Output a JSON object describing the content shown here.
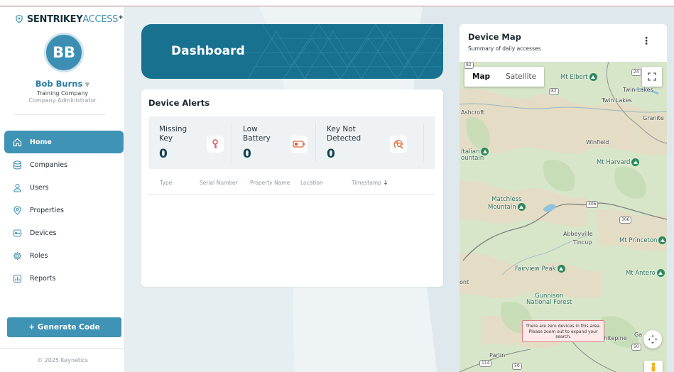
{
  "brand": {
    "name_bold": "SENTRIKEY",
    "name_light": "ACCESS",
    "plus": "+"
  },
  "user": {
    "initials": "BB",
    "name": "Bob Burns",
    "company": "Training Company",
    "role": "Company Administrator"
  },
  "nav": [
    {
      "label": "Home",
      "icon": "home-icon",
      "active": true
    },
    {
      "label": "Companies",
      "icon": "database-icon"
    },
    {
      "label": "Users",
      "icon": "user-icon"
    },
    {
      "label": "Properties",
      "icon": "location-pin-icon"
    },
    {
      "label": "Devices",
      "icon": "key-device-icon"
    },
    {
      "label": "Roles",
      "icon": "gear-icon"
    },
    {
      "label": "Reports",
      "icon": "bar-chart-icon"
    }
  ],
  "generate_button": "+ Generate Code",
  "footer": "© 2025 Keynetics",
  "dashboard": {
    "title": "Dashboard"
  },
  "alerts": {
    "title": "Device Alerts",
    "stats": [
      {
        "label_line1": "Missing",
        "label_line2": "Key",
        "value": "0",
        "icon": "key-icon"
      },
      {
        "label_line1": "Low",
        "label_line2": "Battery",
        "value": "0",
        "icon": "battery-low-icon"
      },
      {
        "label_line1": "Key Not",
        "label_line2": "Detected",
        "value": "0",
        "icon": "key-search-icon"
      }
    ],
    "columns": [
      "Type",
      "Serial Number",
      "Property Name",
      "Location",
      "Timestamp"
    ],
    "sort_arrow": "↓"
  },
  "map": {
    "title": "Device Map",
    "subtitle": "Summary of daily accesses",
    "menu": "⋮",
    "toggle": {
      "map": "Map",
      "satellite": "Satellite"
    },
    "notice_line1": "There are zero devices in this area.",
    "notice_line2": "Please zoom out to expand your",
    "notice_line3": "search.",
    "labels": {
      "mt_elbert": "Mt Elbert",
      "twin_lakes_1": "Twin Lakes",
      "twin_lakes_2": "Twin Lakes",
      "ashcroft": "Ashcroft",
      "granite": "Granite",
      "winfield": "Winfield",
      "italian_1": "Italian",
      "italian_2": "ountain",
      "mt_harvard": "Mt Harvard",
      "matchless_1": "Matchless",
      "matchless_2": "Mountain",
      "abbeyville": "Abbeyville",
      "tincup": "Tincup",
      "mt_princeton": "Mt Princeton",
      "fairview": "Fairview Peak",
      "mt_antero": "Mt Antero",
      "ont": "ont",
      "gunnison_1": "Gunnison",
      "gunnison_2": "National Forest",
      "whitepine": "hitepine",
      "ga": "Ga",
      "parlin": "Parlin",
      "shield_82a": "82",
      "shield_82b": "82",
      "shield_24": "24",
      "shield_306a": "306",
      "shield_306b": "306",
      "shield_50a": "50",
      "shield_50b": "50",
      "shield_114": "114"
    }
  }
}
